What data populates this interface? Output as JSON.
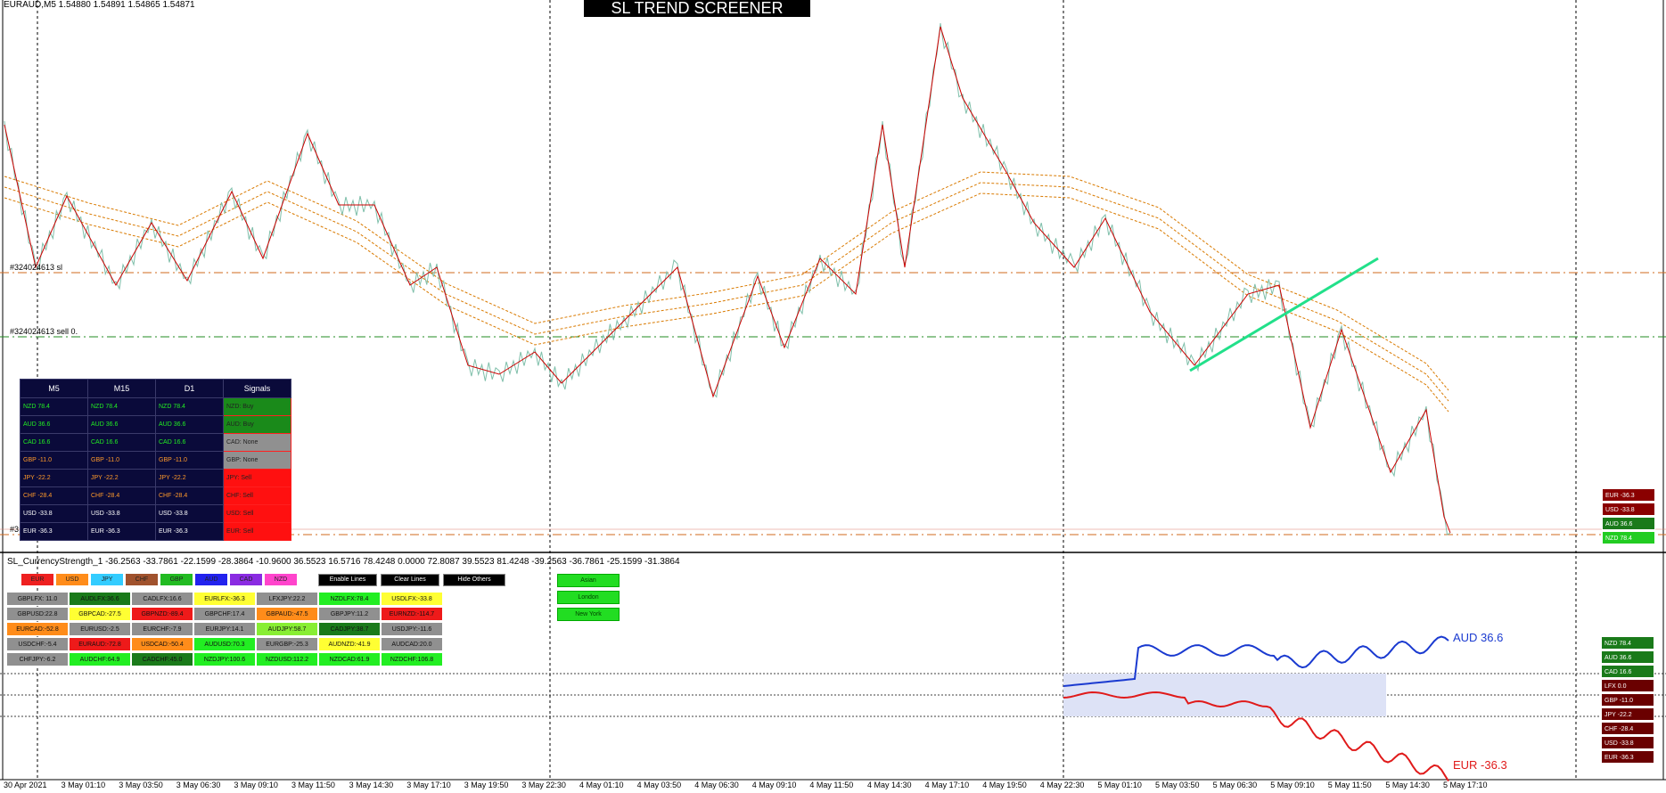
{
  "symbol_info": "EURAUD,M5  1.54880 1.54891 1.54865 1.54871",
  "screener_title": "SL TREND SCREENER",
  "order_lines": {
    "sl_label": "#324024613 sl",
    "sell_label": "#324024613 sell 0.",
    "bottom_label": "#3"
  },
  "signals_table": {
    "headers": [
      "M5",
      "M15",
      "D1",
      "Signals"
    ],
    "rows": [
      {
        "m5": "NZD 78.4",
        "m15": "NZD 78.4",
        "d1": "NZD 78.4",
        "signal": "NZD: Buy",
        "text_color": "#22ee22",
        "signal_color": "#1a8a1a"
      },
      {
        "m5": "AUD 36.6",
        "m15": "AUD 36.6",
        "d1": "AUD 36.6",
        "signal": "AUD: Buy",
        "text_color": "#22ee22",
        "signal_color": "#1a8a1a"
      },
      {
        "m5": "CAD 16.6",
        "m15": "CAD 16.6",
        "d1": "CAD 16.6",
        "signal": "CAD: None",
        "text_color": "#22ee22",
        "signal_color": "#909090"
      },
      {
        "m5": "GBP -11.0",
        "m15": "GBP -11.0",
        "d1": "GBP -11.0",
        "signal": "GBP: None",
        "text_color": "#ff9a2a",
        "signal_color": "#909090"
      },
      {
        "m5": "JPY -22.2",
        "m15": "JPY -22.2",
        "d1": "JPY -22.2",
        "signal": "JPY: Sell",
        "text_color": "#ff9a2a",
        "signal_color": "#ff1010"
      },
      {
        "m5": "CHF -28.4",
        "m15": "CHF -28.4",
        "d1": "CHF -28.4",
        "signal": "CHF: Sell",
        "text_color": "#ff9a2a",
        "signal_color": "#ff1010"
      },
      {
        "m5": "USD -33.8",
        "m15": "USD -33.8",
        "d1": "USD -33.8",
        "signal": "USD: Sell",
        "text_color": "#ffffff",
        "signal_color": "#ff1010"
      },
      {
        "m5": "EUR -36.3",
        "m15": "EUR -36.3",
        "d1": "EUR -36.3",
        "signal": "EUR: Sell",
        "text_color": "#ffffff",
        "signal_color": "#ff1010"
      }
    ]
  },
  "right_panel_top": [
    {
      "text": "EUR -36.3",
      "color": "#8a0000"
    },
    {
      "text": "USD -33.8",
      "color": "#8a0000"
    },
    {
      "text": "AUD 36.6",
      "color": "#1a7a1a"
    },
    {
      "text": "NZD 78.4",
      "color": "#22cc22"
    }
  ],
  "indicator_label": "SL_CurrencyStrength_1 -36.2563 -33.7861 -22.1599 -28.3864 -10.9600 36.5523 16.5716 78.4248 0.0000 72.8087 39.5523 81.4248 -39.2563 -36.7861 -25.1599 -31.3864",
  "currency_buttons": [
    {
      "label": "EUR",
      "color": "#ee2020"
    },
    {
      "label": "USD",
      "color": "#ff8c1a"
    },
    {
      "label": "JPY",
      "color": "#33ccff"
    },
    {
      "label": "CHF",
      "color": "#a0522d"
    },
    {
      "label": "GBP",
      "color": "#22bb22"
    },
    {
      "label": "AUD",
      "color": "#2222ee"
    },
    {
      "label": "CAD",
      "color": "#8a2be2"
    },
    {
      "label": "NZD",
      "color": "#ff44cc"
    }
  ],
  "controls": {
    "enable_lines": "Enable Lines",
    "clear_lines": "Clear Lines",
    "hide_others": "Hide Others"
  },
  "sessions": [
    "Asian",
    "London",
    "New York"
  ],
  "pair_grid": [
    [
      {
        "t": "GBPLFX: 11.0",
        "c": "#909090"
      },
      {
        "t": "AUDLFX:36.6",
        "c": "#1a7a1a"
      },
      {
        "t": "CADLFX:16.6",
        "c": "#909090"
      },
      {
        "t": "EURLFX:-36.3",
        "c": "#ffff33"
      },
      {
        "t": "LFXJPY:22.2",
        "c": "#909090"
      },
      {
        "t": "NZDLFX:78.4",
        "c": "#22ee22"
      },
      {
        "t": "USDLFX:-33.8",
        "c": "#ffff33"
      }
    ],
    [
      {
        "t": "GBPUSD:22.8",
        "c": "#909090"
      },
      {
        "t": "GBPCAD:-27.5",
        "c": "#ffff33"
      },
      {
        "t": "GBPNZD:-89.4",
        "c": "#ee1a1a"
      },
      {
        "t": "GBPCHF:17.4",
        "c": "#909090"
      },
      {
        "t": "GBPAUD:-47.5",
        "c": "#ff8c1a"
      },
      {
        "t": "GBPJPY:11.2",
        "c": "#909090"
      },
      {
        "t": "EURNZD:-114.7",
        "c": "#ee1a1a"
      }
    ],
    [
      {
        "t": "EURCAD:-52.8",
        "c": "#ff8c1a"
      },
      {
        "t": "EURUSD:-2.5",
        "c": "#909090"
      },
      {
        "t": "EURCHF:-7.9",
        "c": "#909090"
      },
      {
        "t": "EURJPY:14.1",
        "c": "#909090"
      },
      {
        "t": "AUDJPY:58.7",
        "c": "#88ee33"
      },
      {
        "t": "CADJPY:38.7",
        "c": "#1a7a1a"
      },
      {
        "t": "USDJPY:-11.6",
        "c": "#909090"
      }
    ],
    [
      {
        "t": "USDCHF:-5.4",
        "c": "#909090"
      },
      {
        "t": "EURAUD:-72.8",
        "c": "#ee1a1a"
      },
      {
        "t": "USDCAD:-50.4",
        "c": "#ff8c1a"
      },
      {
        "t": "AUDUSD:70.3",
        "c": "#22ee22"
      },
      {
        "t": "EURGBP:-25.3",
        "c": "#909090"
      },
      {
        "t": "AUDNZD:-41.9",
        "c": "#ffff33"
      },
      {
        "t": "AUDCAD:20.0",
        "c": "#909090"
      }
    ],
    [
      {
        "t": "CHFJPY:-6.2",
        "c": "#909090"
      },
      {
        "t": "AUDCHF:64.9",
        "c": "#22ee22"
      },
      {
        "t": "CADCHF:45.0",
        "c": "#1a7a1a"
      },
      {
        "t": "NZDJPY:100.6",
        "c": "#22ee22"
      },
      {
        "t": "NZDUSD:112.2",
        "c": "#22ee22"
      },
      {
        "t": "NZDCAD:61.9",
        "c": "#22ee22"
      },
      {
        "t": "NZDCHF:106.8",
        "c": "#22ee22"
      }
    ]
  ],
  "aud_line_label": "AUD  36.6",
  "eur_line_label": "EUR  -36.3",
  "right_panel_bottom": [
    {
      "text": "NZD 78.4",
      "color": "#1a7a1a"
    },
    {
      "text": "AUD 36.6",
      "color": "#1a7a1a"
    },
    {
      "text": "CAD 16.6",
      "color": "#1a7a1a"
    },
    {
      "text": "LFX 0.0",
      "color": "#6a0000"
    },
    {
      "text": "GBP -11.0",
      "color": "#6a0000"
    },
    {
      "text": "JPY -22.2",
      "color": "#6a0000"
    },
    {
      "text": "CHF -28.4",
      "color": "#6a0000"
    },
    {
      "text": "USD -33.8",
      "color": "#6a0000"
    },
    {
      "text": "EUR -36.3",
      "color": "#6a0000"
    }
  ],
  "x_axis_labels": [
    "30 Apr 2021",
    "3 May 01:10",
    "3 May 03:50",
    "3 May 06:30",
    "3 May 09:10",
    "3 May 11:50",
    "3 May 14:30",
    "3 May 17:10",
    "3 May 19:50",
    "3 May 22:30",
    "4 May 01:10",
    "4 May 03:50",
    "4 May 06:30",
    "4 May 09:10",
    "4 May 11:50",
    "4 May 14:30",
    "4 May 17:10",
    "4 May 19:50",
    "4 May 22:30",
    "5 May 01:10",
    "5 May 03:50",
    "5 May 06:30",
    "5 May 09:10",
    "5 May 11:50",
    "5 May 14:30",
    "5 May 17:10"
  ]
}
